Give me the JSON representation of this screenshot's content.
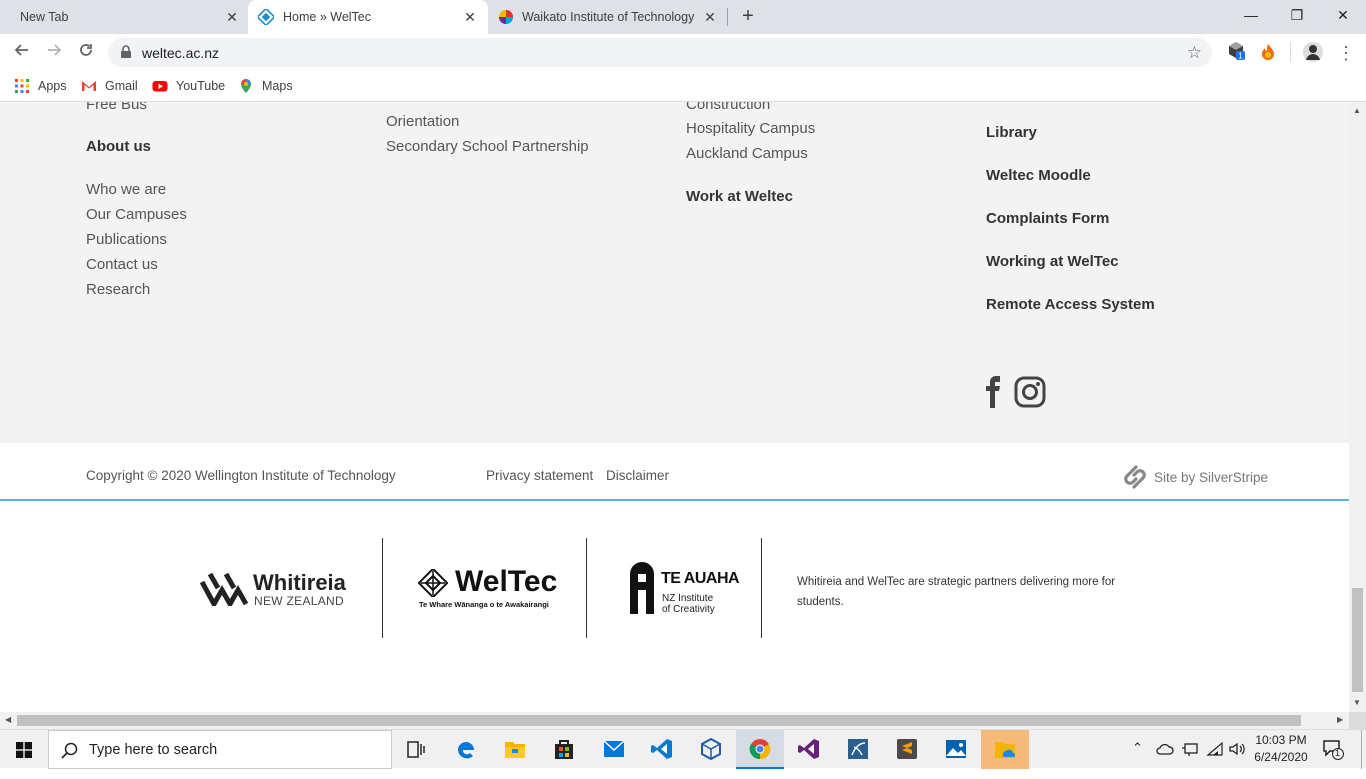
{
  "browser": {
    "tabs": [
      {
        "title": "New Tab",
        "active": false
      },
      {
        "title": "Home » WelTec",
        "active": true
      },
      {
        "title": "Waikato Institute of Technology",
        "active": false
      }
    ],
    "url": "weltec.ac.nz",
    "bookmarks": [
      {
        "label": "Apps",
        "icon": "apps-grid-icon"
      },
      {
        "label": "Gmail",
        "icon": "gmail-icon"
      },
      {
        "label": "YouTube",
        "icon": "youtube-icon"
      },
      {
        "label": "Maps",
        "icon": "maps-icon"
      }
    ],
    "extension_badge": "1"
  },
  "footer": {
    "col1": {
      "partial_top": "Free Bus",
      "heading": "About us",
      "links": [
        "Who we are",
        "Our Campuses",
        "Publications",
        "Contact us",
        "Research"
      ]
    },
    "col2": {
      "links": [
        "Orientation",
        "Secondary School Partnership"
      ]
    },
    "col3": {
      "partial_top": "Construction",
      "links": [
        "Hospitality Campus",
        "Auckland Campus"
      ],
      "heading": "Work at Weltec"
    },
    "col4": {
      "headings": [
        "Library",
        "Weltec Moodle",
        "Complaints Form",
        "Working at WelTec",
        "Remote Access System"
      ],
      "social": [
        "facebook-icon",
        "instagram-icon"
      ]
    },
    "copyright": "Copyright © 2020 Wellington Institute of Technology",
    "privacy": "Privacy statement",
    "disclaimer": "Disclaimer",
    "site_by": "Site by SilverStripe"
  },
  "partners": {
    "whitireia": {
      "name": "Whitireia",
      "sub": "NEW ZEALAND"
    },
    "weltec": {
      "name": "WelTec",
      "sub": "Te Whare Wānanga o te Awakairangi"
    },
    "teauaha": {
      "name": "TE AUAHA",
      "sub1": "NZ Institute",
      "sub2": "of Creativity"
    },
    "blurb": "Whitireia and WelTec are strategic partners delivering more for students."
  },
  "taskbar": {
    "search_placeholder": "Type here to search",
    "time": "10:03 PM",
    "date": "6/24/2020",
    "notifications": "1"
  },
  "colors": {
    "accent_line": "#5bb4d8",
    "footer_bg": "#f3f3f3"
  }
}
